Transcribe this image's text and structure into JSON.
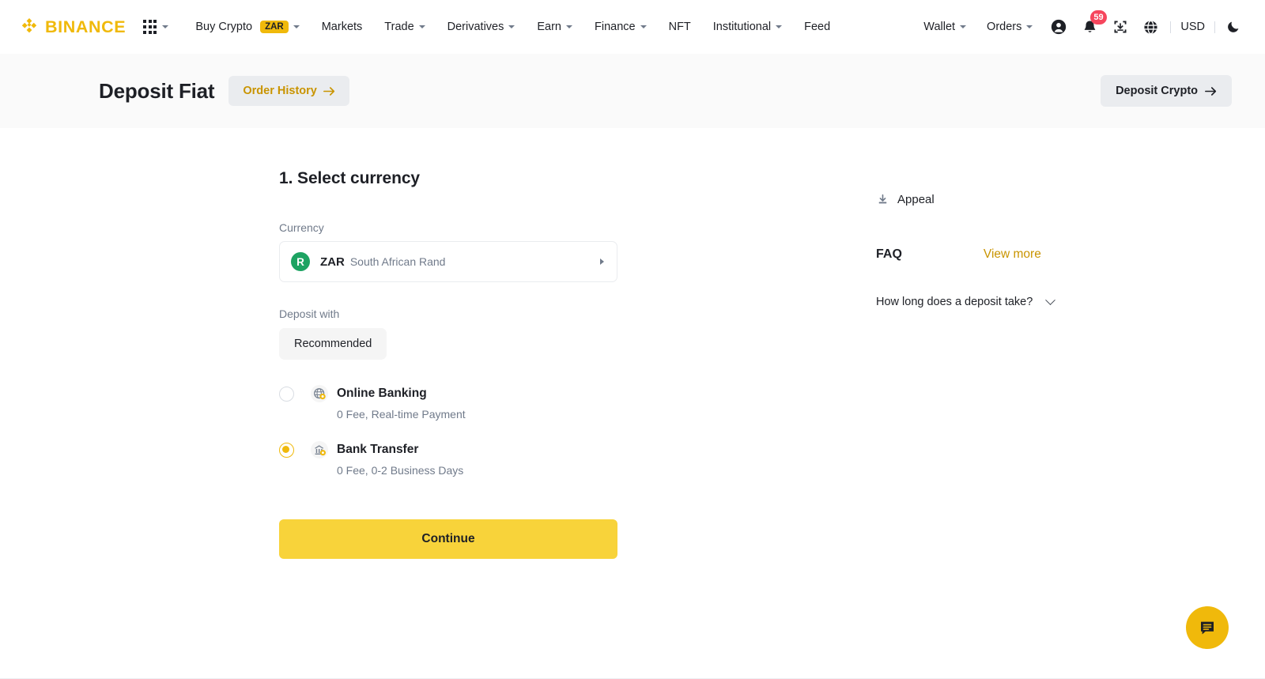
{
  "navbar": {
    "brand": "BINANCE",
    "apps_icon": "grid-apps-icon",
    "items": [
      {
        "label": "Buy Crypto",
        "badge": "ZAR",
        "caret": true
      },
      {
        "label": "Markets",
        "caret": false
      },
      {
        "label": "Trade",
        "caret": true
      },
      {
        "label": "Derivatives",
        "caret": true
      },
      {
        "label": "Earn",
        "caret": true
      },
      {
        "label": "Finance",
        "caret": true
      },
      {
        "label": "NFT",
        "caret": false
      },
      {
        "label": "Institutional",
        "caret": true
      },
      {
        "label": "Feed",
        "caret": false
      }
    ],
    "right_items": [
      {
        "label": "Wallet",
        "caret": true
      },
      {
        "label": "Orders",
        "caret": true
      }
    ],
    "profile_icon": "user-account-icon",
    "notification_icon": "bell-icon",
    "notification_count": "59",
    "download_icon": "download-app-icon",
    "language_icon": "globe-language-icon",
    "currency_label": "USD",
    "theme_icon": "moon-dark-mode-icon"
  },
  "header": {
    "title": "Deposit Fiat",
    "order_history_label": "Order History",
    "order_history_arrow": "arrow-right-icon",
    "deposit_crypto_label": "Deposit Crypto",
    "deposit_crypto_arrow": "arrow-right-icon"
  },
  "main": {
    "step_title": "1. Select currency",
    "currency_label": "Currency",
    "currency": {
      "symbol": "R",
      "code": "ZAR",
      "name": "South African Rand",
      "arrow_icon": "chevron-right-icon"
    },
    "deposit_with_label": "Deposit with",
    "tab_recommended": "Recommended",
    "methods": [
      {
        "name": "Online Banking",
        "desc": "0 Fee, Real-time Payment",
        "icon": "globe-coin-icon",
        "selected": false
      },
      {
        "name": "Bank Transfer",
        "desc": "0 Fee, 0-2 Business Days",
        "icon": "bank-coin-icon",
        "selected": true
      }
    ],
    "continue_label": "Continue"
  },
  "side": {
    "appeal_label": "Appeal",
    "appeal_icon": "appeal-download-icon",
    "faq_title": "FAQ",
    "view_more_label": "View more",
    "faq_question": "How long does a deposit take?",
    "faq_chevron": "chevron-down-icon"
  },
  "chat": {
    "icon": "chat-support-icon"
  },
  "colors": {
    "brand_yellow": "#F0B90B",
    "button_yellow": "#F8D33A",
    "link_gold": "#C99400",
    "badge_red": "#F6465D",
    "currency_green": "#1DA362",
    "text_primary": "#1E2026",
    "text_muted": "#707a8a",
    "band_grey": "#FAFAFA",
    "pill_grey": "#EAECEF"
  }
}
